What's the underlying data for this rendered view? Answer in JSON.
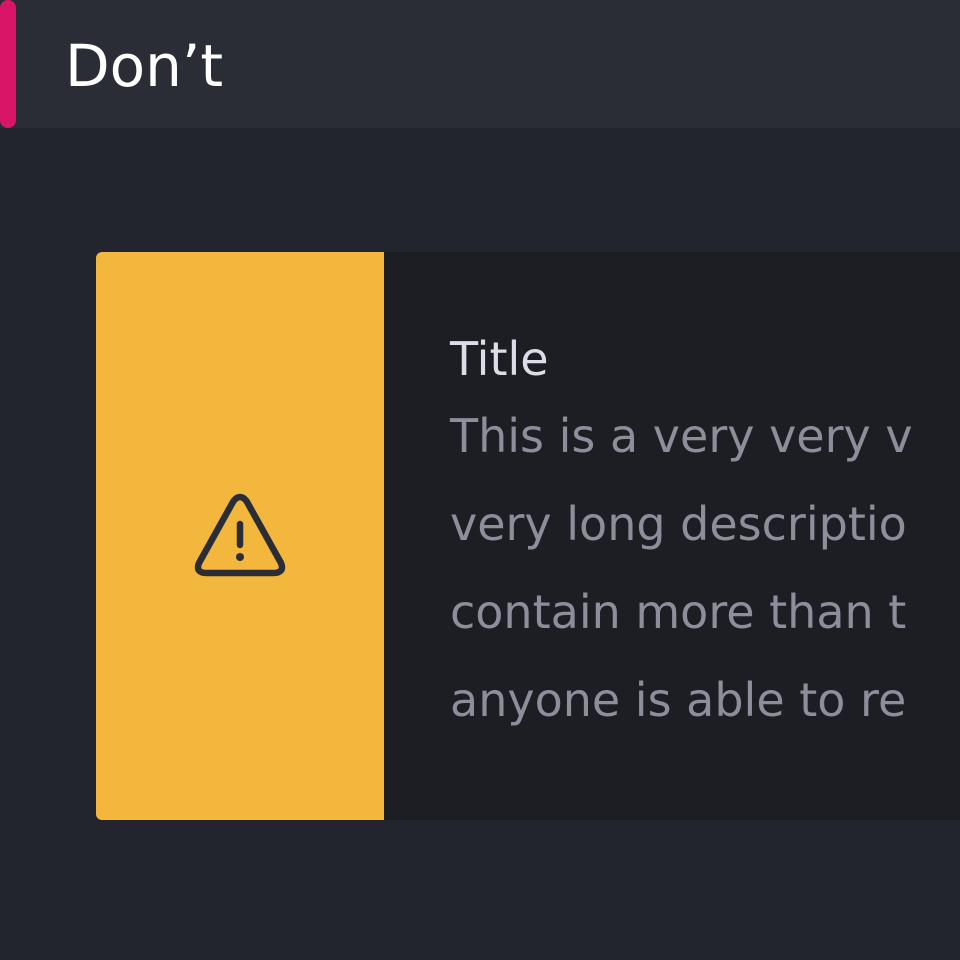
{
  "header": {
    "title": "Don’t"
  },
  "toast": {
    "icon": "warning-triangle-icon",
    "title": "Title",
    "description_lines": [
      "This is a very very v",
      "very long descriptio",
      "contain more than t",
      "anyone is able to re"
    ]
  },
  "colors": {
    "header_accent": "#d91567",
    "icon_panel": "#f3b73d",
    "icon_stroke": "#2a2d36"
  }
}
